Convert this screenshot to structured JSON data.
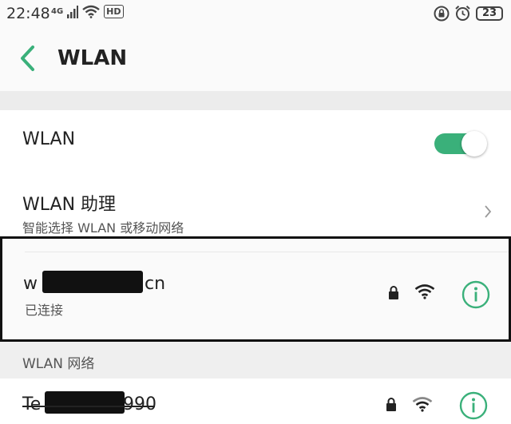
{
  "status_bar": {
    "time": "22:48",
    "network_tag": "4G",
    "hd_tag": "HD",
    "battery": "23"
  },
  "header": {
    "title": "WLAN"
  },
  "wlan_toggle": {
    "label": "WLAN",
    "state": "on",
    "accent": "#3ab07a"
  },
  "assistant": {
    "label": "WLAN 助理",
    "subtitle": "智能选择 WLAN 或移动网络"
  },
  "connected_network": {
    "ssid_start": "w",
    "ssid_end": "cn",
    "status": "已连接"
  },
  "networks_section": {
    "header": "WLAN 网络"
  },
  "other_network": {
    "ssid_start": "Te",
    "ssid_end": "990"
  }
}
